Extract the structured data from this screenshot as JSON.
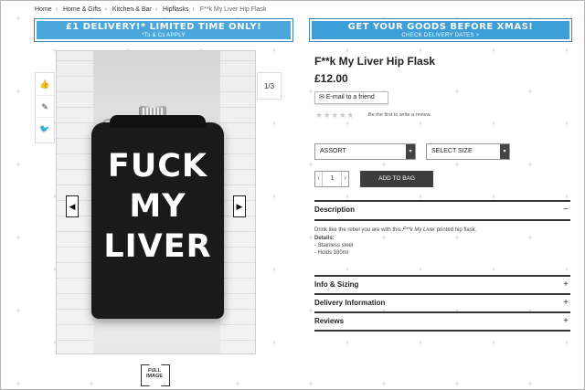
{
  "breadcrumb": [
    "Home",
    "Home & Gifts",
    "Kitchen & Bar",
    "Hipflasks",
    "F**k My Liver Hip Flask"
  ],
  "banners": {
    "left_main": "£1 DELIVERY!* LIMITED TIME ONLY!",
    "left_sub": "*Ts & Cs APPLY",
    "right_main": "GET YOUR GOODS BEFORE XMAS!",
    "right_sub": "CHECK DELIVERY DATES >"
  },
  "gallery": {
    "counter": "1/3",
    "flask_lines": [
      "FUCK",
      "MY",
      "LIVER"
    ],
    "full_image_label": "FULL IMAGE"
  },
  "share": [
    {
      "icon": "thumbs-up-icon",
      "glyph": "👍"
    },
    {
      "icon": "pin-icon",
      "glyph": "✎"
    },
    {
      "icon": "twitter-icon",
      "glyph": "🐦"
    }
  ],
  "product": {
    "title": "F**k My Liver Hip Flask",
    "price": "£12.00",
    "email_label": "E-mail to a friend",
    "stars": "★★★★★",
    "review_text": "Be the first to write a review.",
    "color_select": "ASSORT",
    "size_select": "SELECT SIZE",
    "qty": "1",
    "add_to_bag": "ADD TO BAG"
  },
  "sections": {
    "description": "Description",
    "description_toggle": "−",
    "desc_text_pre": "Drink like the rebel you are with this ",
    "desc_text_em": "F**k My Liver",
    "desc_text_post": " printed hip flask.",
    "details_label": "Details:",
    "details": [
      "- Stainless steel",
      "- Holds 180ml"
    ],
    "info": "Info & Sizing",
    "delivery": "Delivery Information",
    "reviews": "Reviews",
    "expand_toggle": "+"
  },
  "colors": {
    "banner_blue": "#4aa7db",
    "button_dark": "#3c3c3c"
  }
}
